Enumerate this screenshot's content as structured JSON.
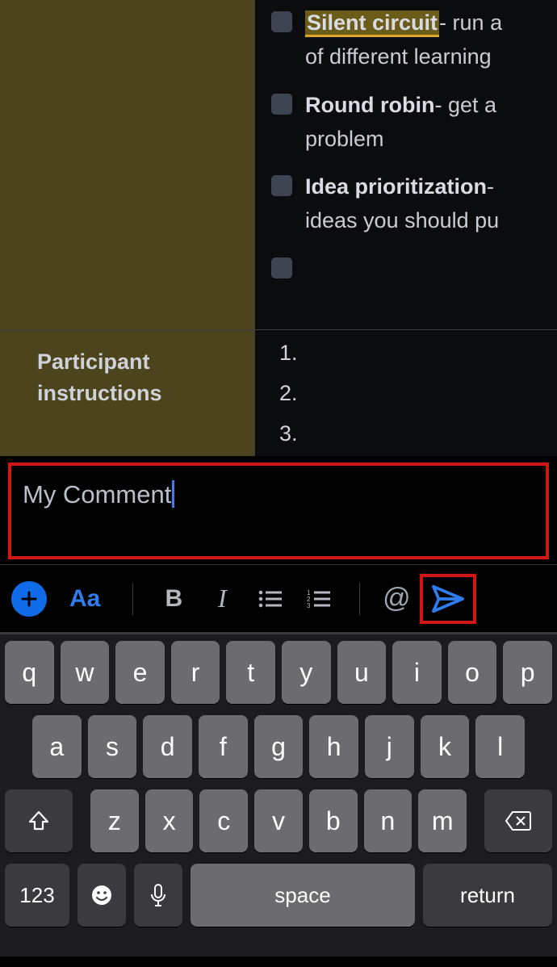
{
  "doc": {
    "items": [
      {
        "title": "Silent circuit",
        "rest": "- run a",
        "line2": "of different learning",
        "highlighted": true
      },
      {
        "title": "Round robin",
        "rest": "- get a",
        "line2": "problem",
        "highlighted": false
      },
      {
        "title": "Idea prioritization",
        "rest": "-",
        "line2": "ideas you should pu",
        "highlighted": false
      }
    ],
    "section_label": "Participant instructions",
    "ordered": [
      "1.",
      "2.",
      "3."
    ]
  },
  "comment": {
    "text": "My Comment"
  },
  "toolbar": {
    "aa": "Aa",
    "bold": "B",
    "italic": "I",
    "mention": "@"
  },
  "keyboard": {
    "row1": [
      "q",
      "w",
      "e",
      "r",
      "t",
      "y",
      "u",
      "i",
      "o",
      "p"
    ],
    "row2": [
      "a",
      "s",
      "d",
      "f",
      "g",
      "h",
      "j",
      "k",
      "l"
    ],
    "row3": [
      "z",
      "x",
      "c",
      "v",
      "b",
      "n",
      "m"
    ],
    "numKey": "123",
    "space": "space",
    "return": "return"
  }
}
